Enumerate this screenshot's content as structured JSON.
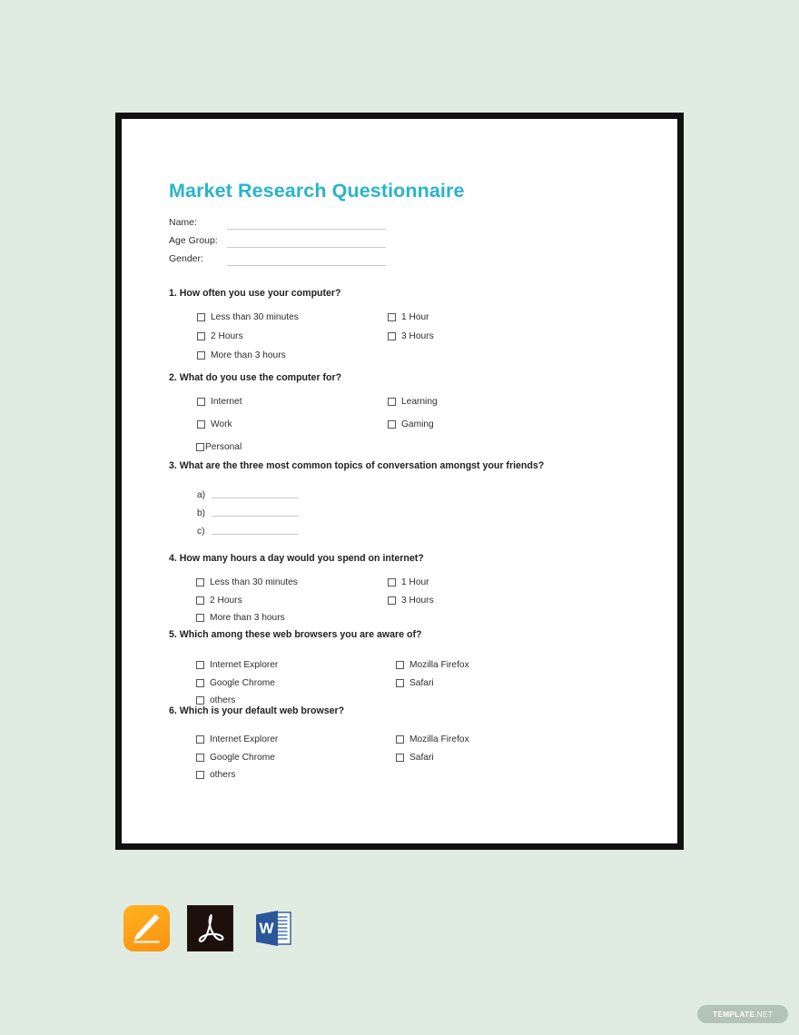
{
  "theme": {
    "canvas_bg": "#e0ebe2",
    "paper_bg": "#ffffff",
    "frame_border": "#111111",
    "title_color": "#29b4cc",
    "text_color": "#2e2e2e",
    "rule_color": "#c9c9c9"
  },
  "document": {
    "title": "Market Research Questionnaire",
    "identity_fields": [
      {
        "label": "Name:"
      },
      {
        "label": "Age Group:"
      },
      {
        "label": "Gender:"
      }
    ],
    "questions": [
      {
        "number": "1.",
        "text": "1. How often you use your computer?",
        "type": "checkbox",
        "left_options": [
          "Less than 30 minutes",
          "2 Hours",
          "More than 3 hours"
        ],
        "right_options": [
          "1 Hour",
          "3 Hours"
        ]
      },
      {
        "number": "2.",
        "text": "2. What do you use the computer for?",
        "type": "checkbox",
        "left_options": [
          "Internet",
          "Work",
          "Personal"
        ],
        "right_options": [
          "Learning",
          "Gaming"
        ]
      },
      {
        "number": "3.",
        "text": "3. What are the three most common topics of conversation amongst your friends?",
        "type": "fill-in",
        "fill_rows": [
          "a)",
          "b)",
          "c)"
        ]
      },
      {
        "number": "4.",
        "text": "4. How many hours a day would you spend on internet?",
        "type": "checkbox",
        "left_options": [
          "Less than 30 minutes",
          "2 Hours",
          "More than 3 hours"
        ],
        "right_options": [
          "1 Hour",
          "3 Hours"
        ]
      },
      {
        "number": "5.",
        "text": "5. Which among these web browsers you are aware of?",
        "type": "checkbox",
        "left_options": [
          "Internet Explorer",
          "Google Chrome",
          "others"
        ],
        "right_options": [
          "Mozilla Firefox",
          "Safari"
        ]
      },
      {
        "number": "6.",
        "text": "6. Which is your default web browser?",
        "type": "checkbox",
        "left_options": [
          "Internet Explorer",
          "Google Chrome",
          "others"
        ],
        "right_options": [
          "Mozilla Firefox",
          "Safari"
        ]
      }
    ]
  },
  "formats": [
    {
      "name": "apple-pages",
      "label": "Pages",
      "color": "#fb9213"
    },
    {
      "name": "adobe-pdf",
      "label": "PDF",
      "color": "#1c0f0c"
    },
    {
      "name": "microsoft-word",
      "label": "Word",
      "color": "#2b579a",
      "letter": "W"
    }
  ],
  "watermark": {
    "strong": "TEMPLATE",
    "light": ".NET"
  }
}
